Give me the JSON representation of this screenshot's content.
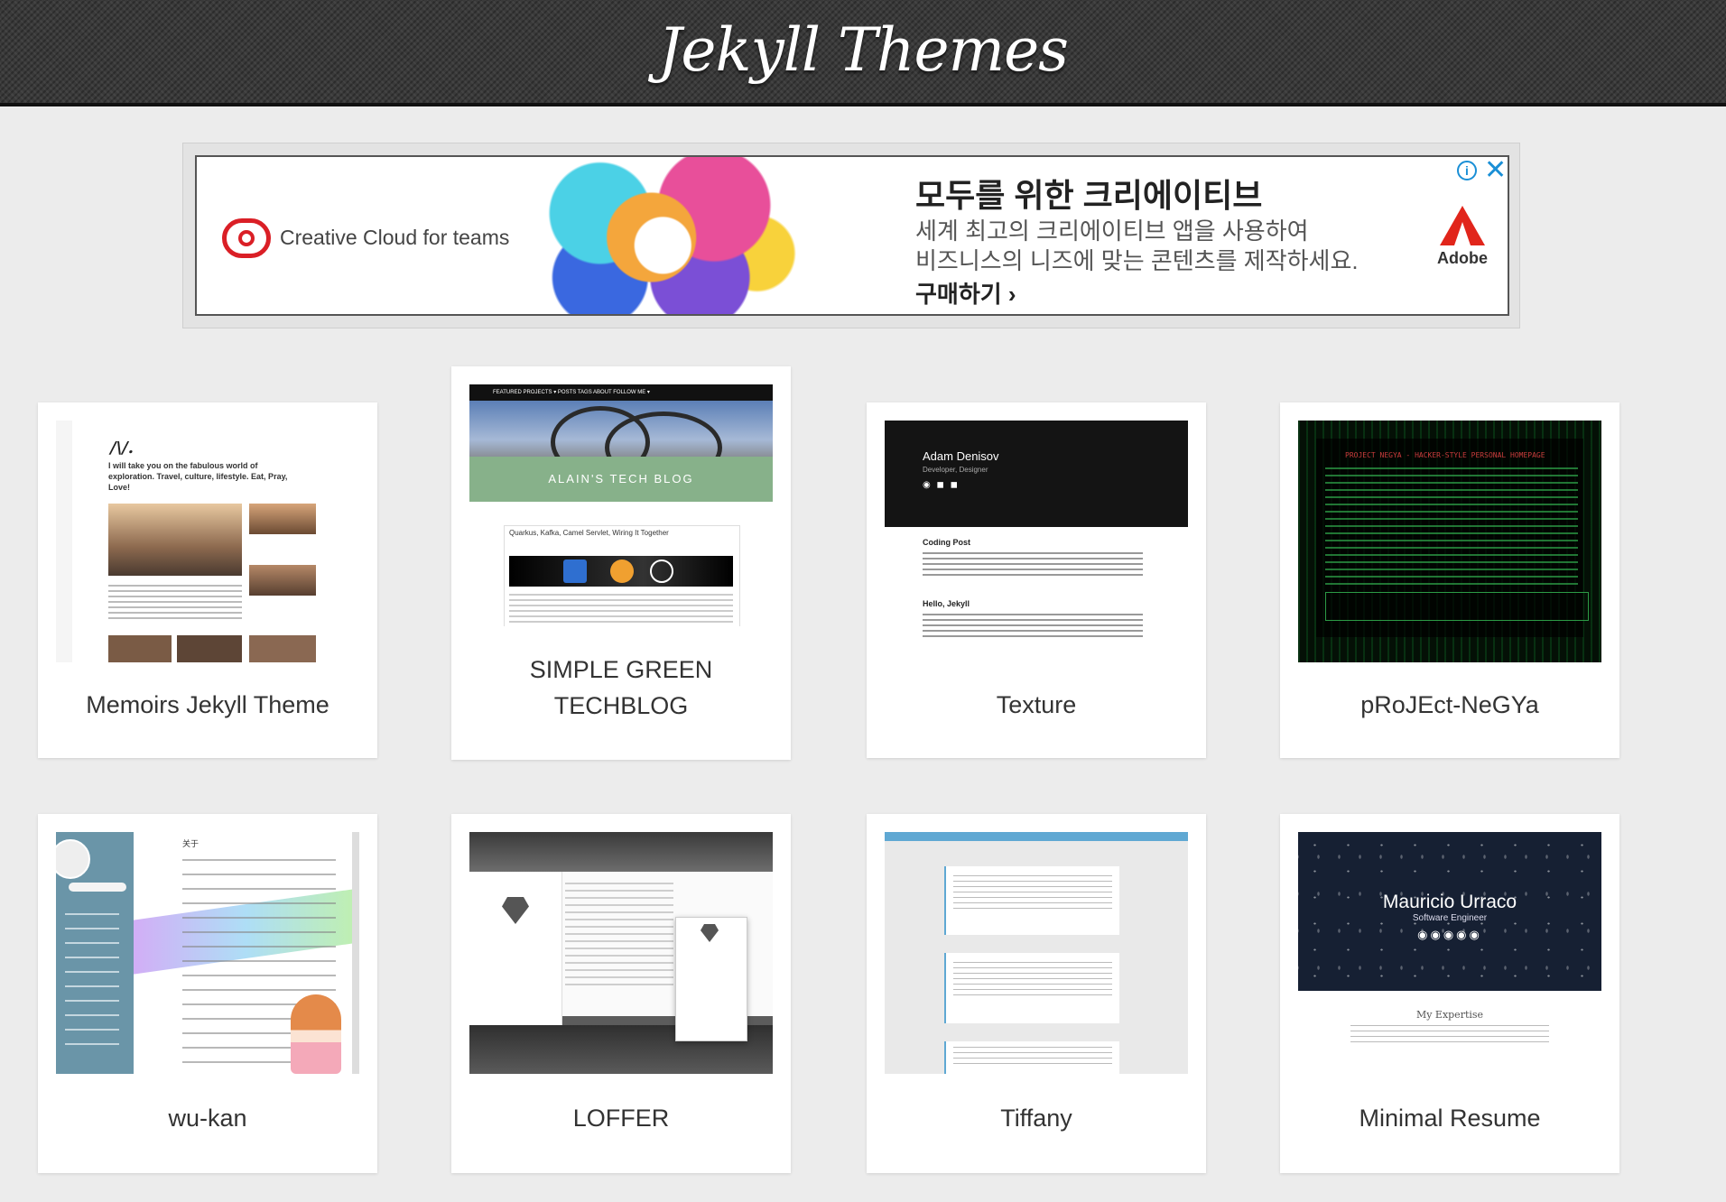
{
  "site": {
    "title": "Jekyll Themes"
  },
  "ad": {
    "brand": "Creative Cloud for teams",
    "headline": "모두를 위한 크리에이티브",
    "body_line1": "세계 최고의 크리에이티브 앱을 사용하여",
    "body_line2": "비즈니스의 니즈에 맞는 콘텐츠를 제작하세요.",
    "cta": "구매하기 ›",
    "advertiser": "Adobe",
    "info_icon": "info-icon",
    "close_icon": "close-icon"
  },
  "themes": [
    {
      "name": "Memoirs Jekyll Theme",
      "preview": {
        "logo": "/\\/.",
        "intro": "I will take you on the fabulous world of exploration. Travel, culture, lifestyle. Eat, Pray, Love!"
      }
    },
    {
      "name": "SIMPLE GREEN TECHBLOG",
      "name_line1": "SIMPLE GREEN",
      "name_line2": "TECHBLOG",
      "preview": {
        "nav": "FEATURED PROJECTS ▾   POSTS   TAGS   ABOUT   FOLLOW ME ▾",
        "banner": "ALAIN'S TECH BLOG",
        "post_title": "Quarkus, Kafka, Camel Servlet, Wiring It Together"
      }
    },
    {
      "name": "Texture",
      "preview": {
        "author": "Adam Denisov",
        "role": "Developer, Designer",
        "post1": "Coding Post",
        "post2": "Hello, Jekyll"
      }
    },
    {
      "name": "pRoJEct-NeGYa",
      "preview": {
        "heading": "PROJECT NEGYA - HACKER-STYLE PERSONAL HOMEPAGE"
      }
    },
    {
      "name": "wu-kan",
      "preview": {
        "page_title": "关于"
      }
    },
    {
      "name": "LOFFER"
    },
    {
      "name": "Tiffany"
    },
    {
      "name": "Minimal Resume",
      "preview": {
        "person": "Mauricio Urraco",
        "role": "Software Engineer",
        "section": "My Expertise"
      }
    }
  ]
}
